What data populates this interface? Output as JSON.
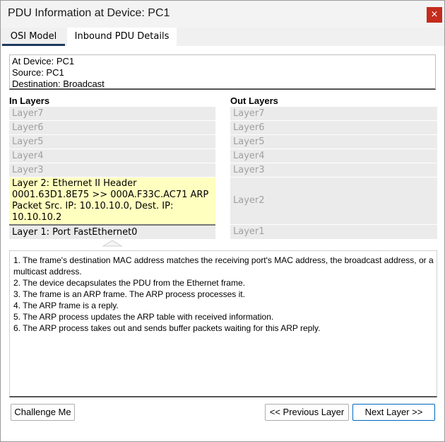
{
  "window": {
    "title": "PDU Information at Device: PC1",
    "close_glyph": "×"
  },
  "tabs": [
    {
      "label": "OSI Model",
      "active": true
    },
    {
      "label": "Inbound PDU Details",
      "active": false
    }
  ],
  "info": {
    "device": "At Device: PC1",
    "source": "Source: PC1",
    "destination": "Destination: Broadcast"
  },
  "in_layers": {
    "header": "In Layers",
    "layer7": "Layer7",
    "layer6": "Layer6",
    "layer5": "Layer5",
    "layer4": "Layer4",
    "layer3": "Layer3",
    "layer2_lines": [
      "Layer 2: Ethernet II Header",
      "0001.63D1.8E75 >> 000A.F33C.AC71 ARP",
      "Packet Src. IP: 10.10.10.0, Dest. IP:",
      "10.10.10.2"
    ],
    "layer1": "Layer 1: Port FastEthernet0"
  },
  "out_layers": {
    "header": "Out Layers",
    "layer7": "Layer7",
    "layer6": "Layer6",
    "layer5": "Layer5",
    "layer4": "Layer4",
    "layer3": "Layer3",
    "layer2": "Layer2",
    "layer1": "Layer1"
  },
  "details": [
    "1. The frame's destination MAC address matches the receiving port's MAC address, the broadcast address, or a multicast address.",
    "2. The device decapsulates the PDU from the Ethernet frame.",
    "3. The frame is an ARP frame. The ARP process processes it.",
    "4. The ARP frame is a reply.",
    "5. The ARP process updates the ARP table with received information.",
    "6. The ARP process takes out and sends buffer packets waiting for this ARP reply."
  ],
  "buttons": {
    "challenge": "Challenge Me",
    "previous": "<< Previous Layer",
    "next": "Next Layer >>"
  },
  "colors": {
    "active_layer": "#ffffc0",
    "close_button": "#c42b1c",
    "tab_underline": "#1f3a5f"
  }
}
